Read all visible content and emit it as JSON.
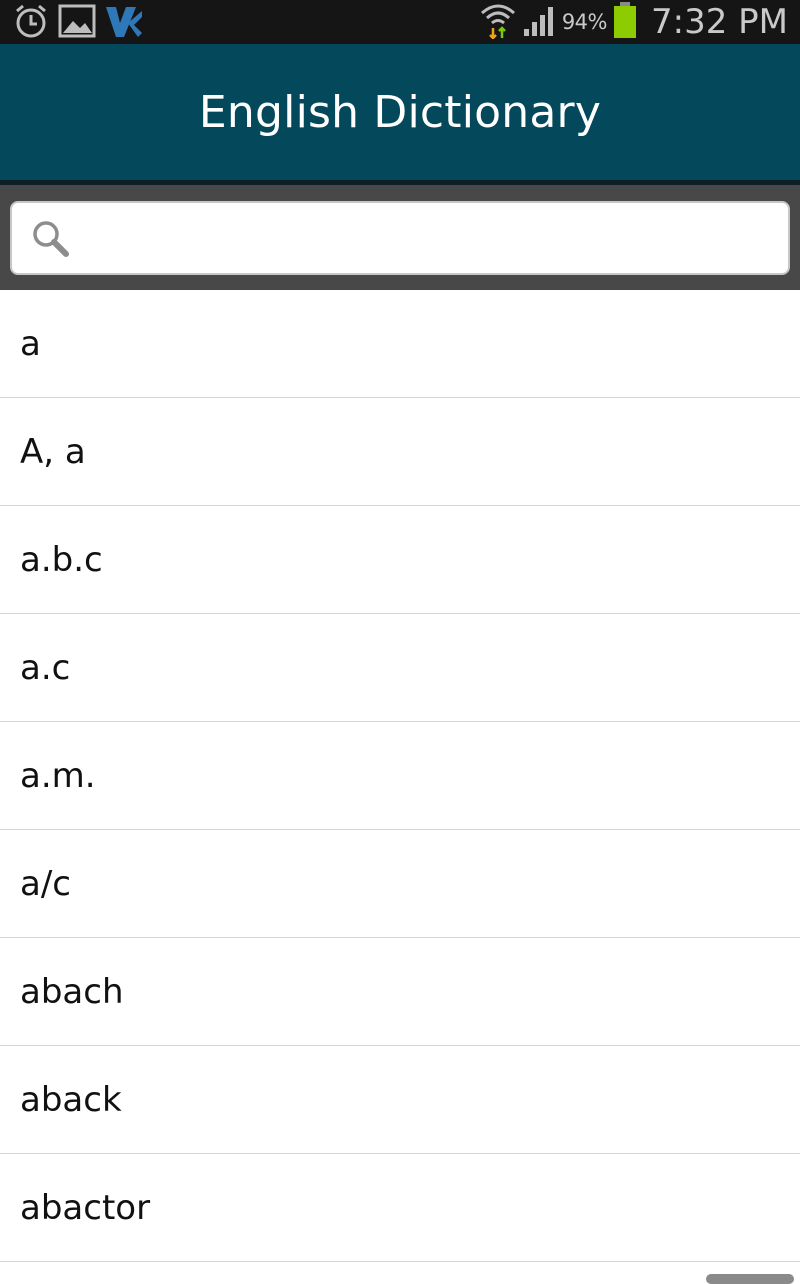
{
  "status_bar": {
    "battery_percent": "94%",
    "time": "7:32 PM",
    "icons": [
      "alarm-icon",
      "gallery-icon",
      "app-logo-icon",
      "wifi-icon",
      "signal-icon",
      "battery-icon"
    ],
    "battery_color": "#8ccc00"
  },
  "header": {
    "title": "English Dictionary",
    "background": "#04485c"
  },
  "search": {
    "placeholder": "",
    "value": ""
  },
  "words": [
    "a",
    "A, a",
    "a.b.c",
    "a.c",
    "a.m.",
    "a/c",
    "abach",
    "aback",
    "abactor"
  ]
}
